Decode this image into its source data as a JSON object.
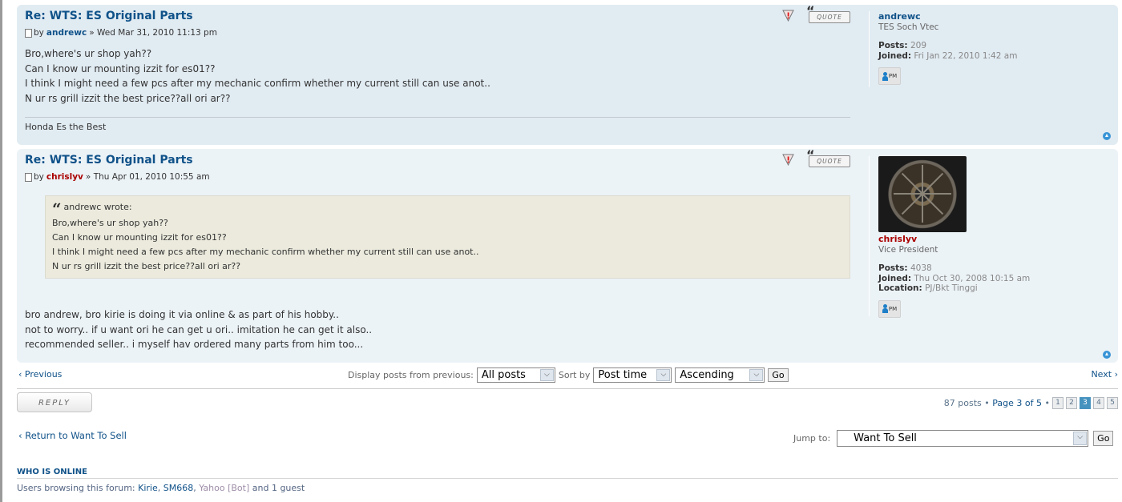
{
  "posts": [
    {
      "title": "Re: WTS: ES Original Parts",
      "by_label": "by",
      "author": "andrewc",
      "separator": "»",
      "date": "Wed Mar 31, 2010 11:13 pm",
      "body_lines": [
        "Bro,where's ur shop yah??",
        "Can I know ur mounting izzit for es01??",
        "I think I might need a few pcs after my mechanic confirm whether my current still can use anot..",
        "N ur rs grill izzit the best price??all ori ar??"
      ],
      "signature": "Honda Es the Best",
      "quote_label": "QUOTE",
      "profile": {
        "username": "andrewc",
        "rank": "TES Soch Vtec",
        "posts_label": "Posts:",
        "posts": "209",
        "joined_label": "Joined:",
        "joined": "Fri Jan 22, 2010 1:42 am",
        "pm_label": "PM"
      }
    },
    {
      "title": "Re: WTS: ES Original Parts",
      "by_label": "by",
      "author": "chrislyv",
      "separator": "»",
      "date": "Thu Apr 01, 2010 10:55 am",
      "quote": {
        "cite": "andrewc wrote:",
        "lines": [
          "Bro,where's ur shop yah??",
          "Can I know ur mounting izzit for es01??",
          "I think I might need a few pcs after my mechanic confirm whether my current still can use anot..",
          "N ur rs grill izzit the best price??all ori ar??"
        ]
      },
      "body_lines": [
        "bro andrew, bro kirie is doing it via online & as part of his hobby..",
        "not to worry.. if u want ori he can get u ori.. imitation he can get it also..",
        "recommended seller.. i myself hav ordered many parts from him too..."
      ],
      "quote_label": "QUOTE",
      "profile": {
        "username": "chrislyv",
        "rank": "Vice President",
        "posts_label": "Posts:",
        "posts": "4038",
        "joined_label": "Joined:",
        "joined": "Thu Oct 30, 2008 10:15 am",
        "location_label": "Location:",
        "location": "PJ/Bkt Tinggi",
        "pm_label": "PM"
      }
    }
  ],
  "nav": {
    "previous": "Previous",
    "next": "Next",
    "display_label": "Display posts from previous:",
    "display_value": "All posts",
    "sort_label": "Sort by",
    "sort_value": "Post time",
    "order_value": "Ascending",
    "go": "Go"
  },
  "reply_label": "REPLY",
  "pagination": {
    "summary": "87 posts",
    "page_label": "Page 3 of 5",
    "pages": [
      "1",
      "2",
      "3",
      "4",
      "5"
    ],
    "current": "3"
  },
  "return_link": "Return to Want To Sell",
  "jump": {
    "label": "Jump to:",
    "value": "Want To Sell",
    "go": "Go"
  },
  "who_is_online": {
    "title": "WHO IS ONLINE",
    "prefix": "Users browsing this forum:",
    "users": [
      "Kirie",
      "SM668"
    ],
    "bot": "Yahoo [Bot]",
    "suffix": "and 1 guest"
  }
}
